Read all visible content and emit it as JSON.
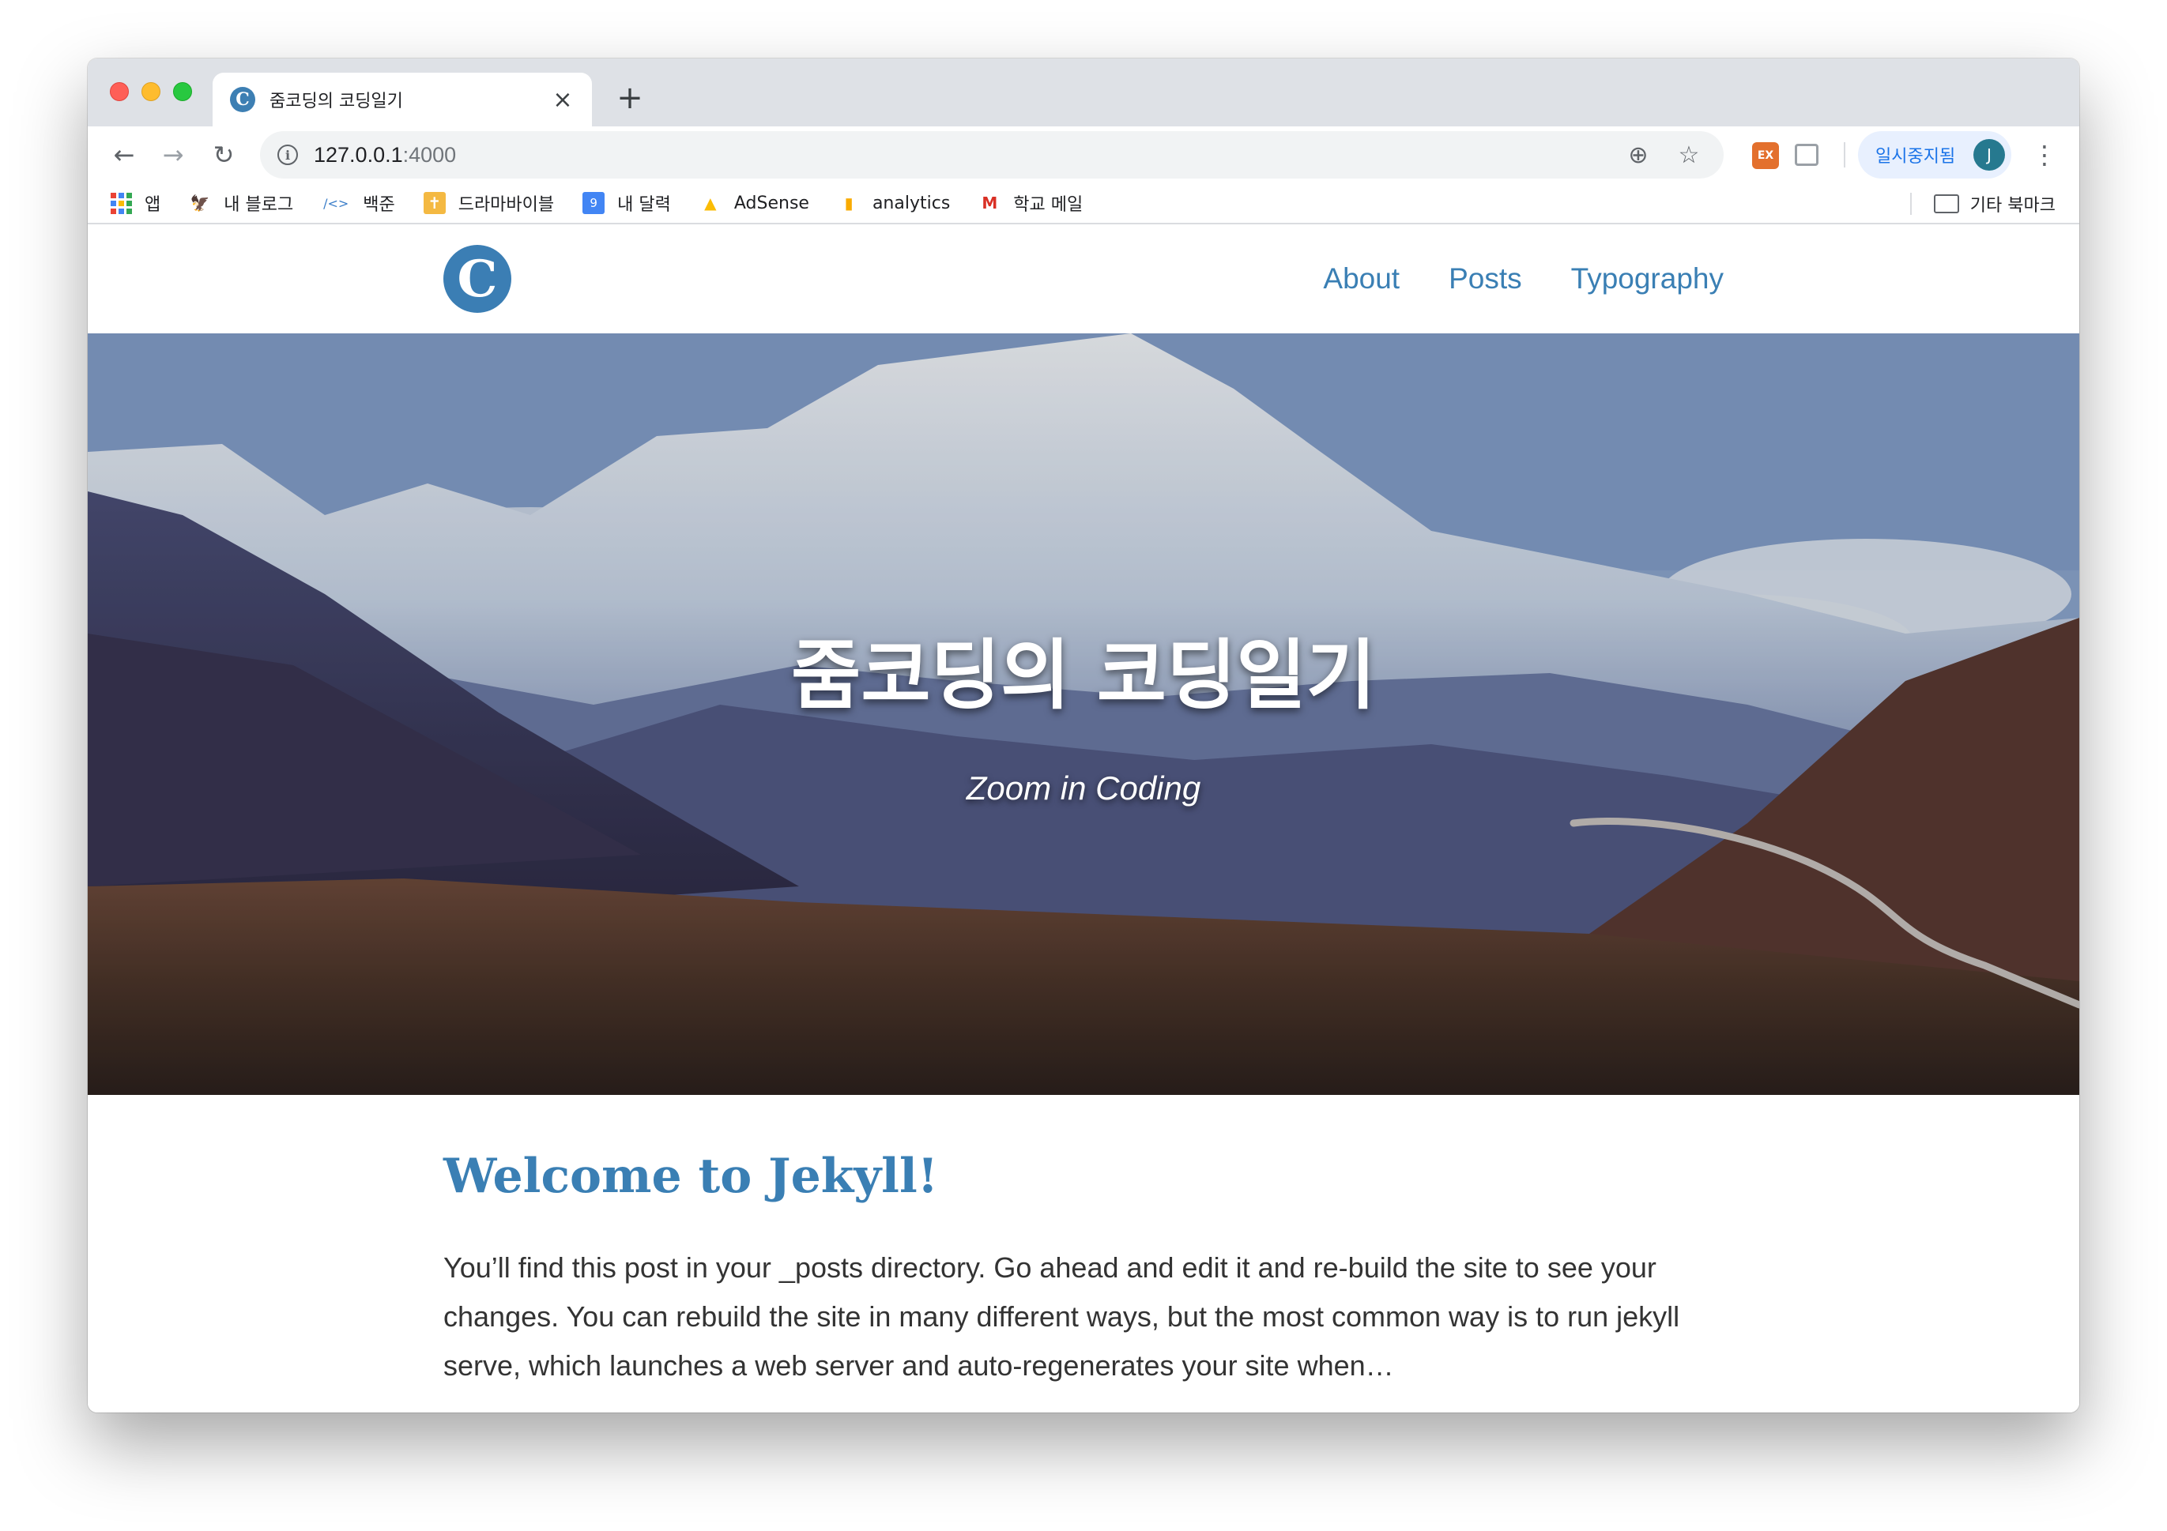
{
  "browser": {
    "tab": {
      "title": "줌코딩의 코딩일기",
      "close_glyph": "×"
    },
    "new_tab_glyph": "+",
    "nav": {
      "back_glyph": "←",
      "forward_glyph": "→",
      "reload_glyph": "↻"
    },
    "omnibox": {
      "url_host": "127.0.0.1",
      "url_port": ":4000",
      "info_glyph": "i",
      "zoom_glyph": "⊕",
      "star_glyph": "☆"
    },
    "extension_ex_label": "EX",
    "profile": {
      "paused_label": "일시중지됨",
      "avatar_letter": "J"
    },
    "menu_glyph": "⋮",
    "bookmarks": [
      {
        "label": "앱",
        "icon": "apps-grid-icon"
      },
      {
        "label": "내 블로그",
        "icon": "blog-icon",
        "glyph": "🦅"
      },
      {
        "label": "백준",
        "icon": "code-icon",
        "glyph": "/<>"
      },
      {
        "label": "드라마바이블",
        "icon": "bible-icon",
        "glyph": "✝"
      },
      {
        "label": "내 달력",
        "icon": "calendar-icon",
        "glyph": "9"
      },
      {
        "label": "AdSense",
        "icon": "adsense-icon",
        "glyph": "▲"
      },
      {
        "label": "analytics",
        "icon": "analytics-icon",
        "glyph": "▮"
      },
      {
        "label": "학교 메일",
        "icon": "gmail-icon",
        "glyph": "M"
      }
    ],
    "other_bookmarks": "기타 북마크"
  },
  "site": {
    "logo_letter": "C",
    "nav": [
      "About",
      "Posts",
      "Typography"
    ],
    "hero": {
      "title": "줌코딩의 코딩일기",
      "subtitle": "Zoom in Coding"
    },
    "post": {
      "title": "Welcome to Jekyll!",
      "excerpt": "You’ll find this post in your _posts directory. Go ahead and edit it and re-build the site to see your changes. You can rebuild the site in many different ways, but the most common way is to run jekyll serve, which launches a web server and auto-regenerates your site when…"
    }
  },
  "colors": {
    "accent": "#3a7fb4",
    "tabstrip": "#dee1e6",
    "paused_chip_bg": "#e8f0fe",
    "avatar": "#26798f"
  }
}
